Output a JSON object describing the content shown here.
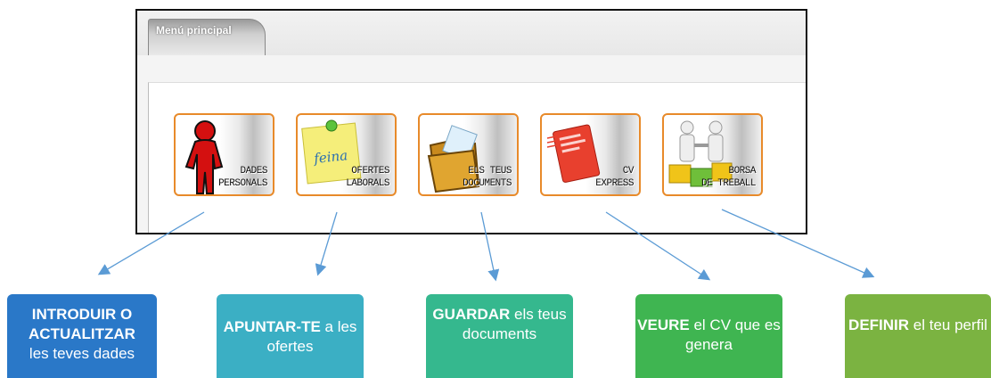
{
  "window": {
    "tab_label": "Menú principal"
  },
  "tiles": [
    {
      "line1": "DADES",
      "line2": "PERSONALS",
      "icon": "person-icon"
    },
    {
      "line1": "OFERTES",
      "line2": "LABORALS",
      "icon": "sticky-note-icon",
      "note_text": "feina"
    },
    {
      "line1": "ELS TEUS",
      "line2": "DOCUMENTS",
      "icon": "folder-icon"
    },
    {
      "line1": "CV",
      "line2": "EXPRESS",
      "icon": "cv-card-icon"
    },
    {
      "line1": "BORSA",
      "line2": "DE TREBALL",
      "icon": "handshake-puzzle-icon"
    }
  ],
  "callouts": [
    {
      "bold": "INTRODUIR O ACTUALITZAR",
      "rest": "les teves dades",
      "color": "#2a78c8"
    },
    {
      "bold": "APUNTAR-TE",
      "rest": " a les ofertes",
      "color": "#3bafc4"
    },
    {
      "bold": "GUARDAR",
      "rest": " els teus documents",
      "color": "#35b88e"
    },
    {
      "bold": "VEURE",
      "rest": " el CV que es genera",
      "color": "#3fb551"
    },
    {
      "bold": "DEFINIR",
      "rest": " el teu perfil",
      "color": "#7bb341"
    }
  ],
  "colors": {
    "tile_border": "#e88a2a",
    "arrow": "#5b9bd5",
    "frame": "#111111"
  }
}
